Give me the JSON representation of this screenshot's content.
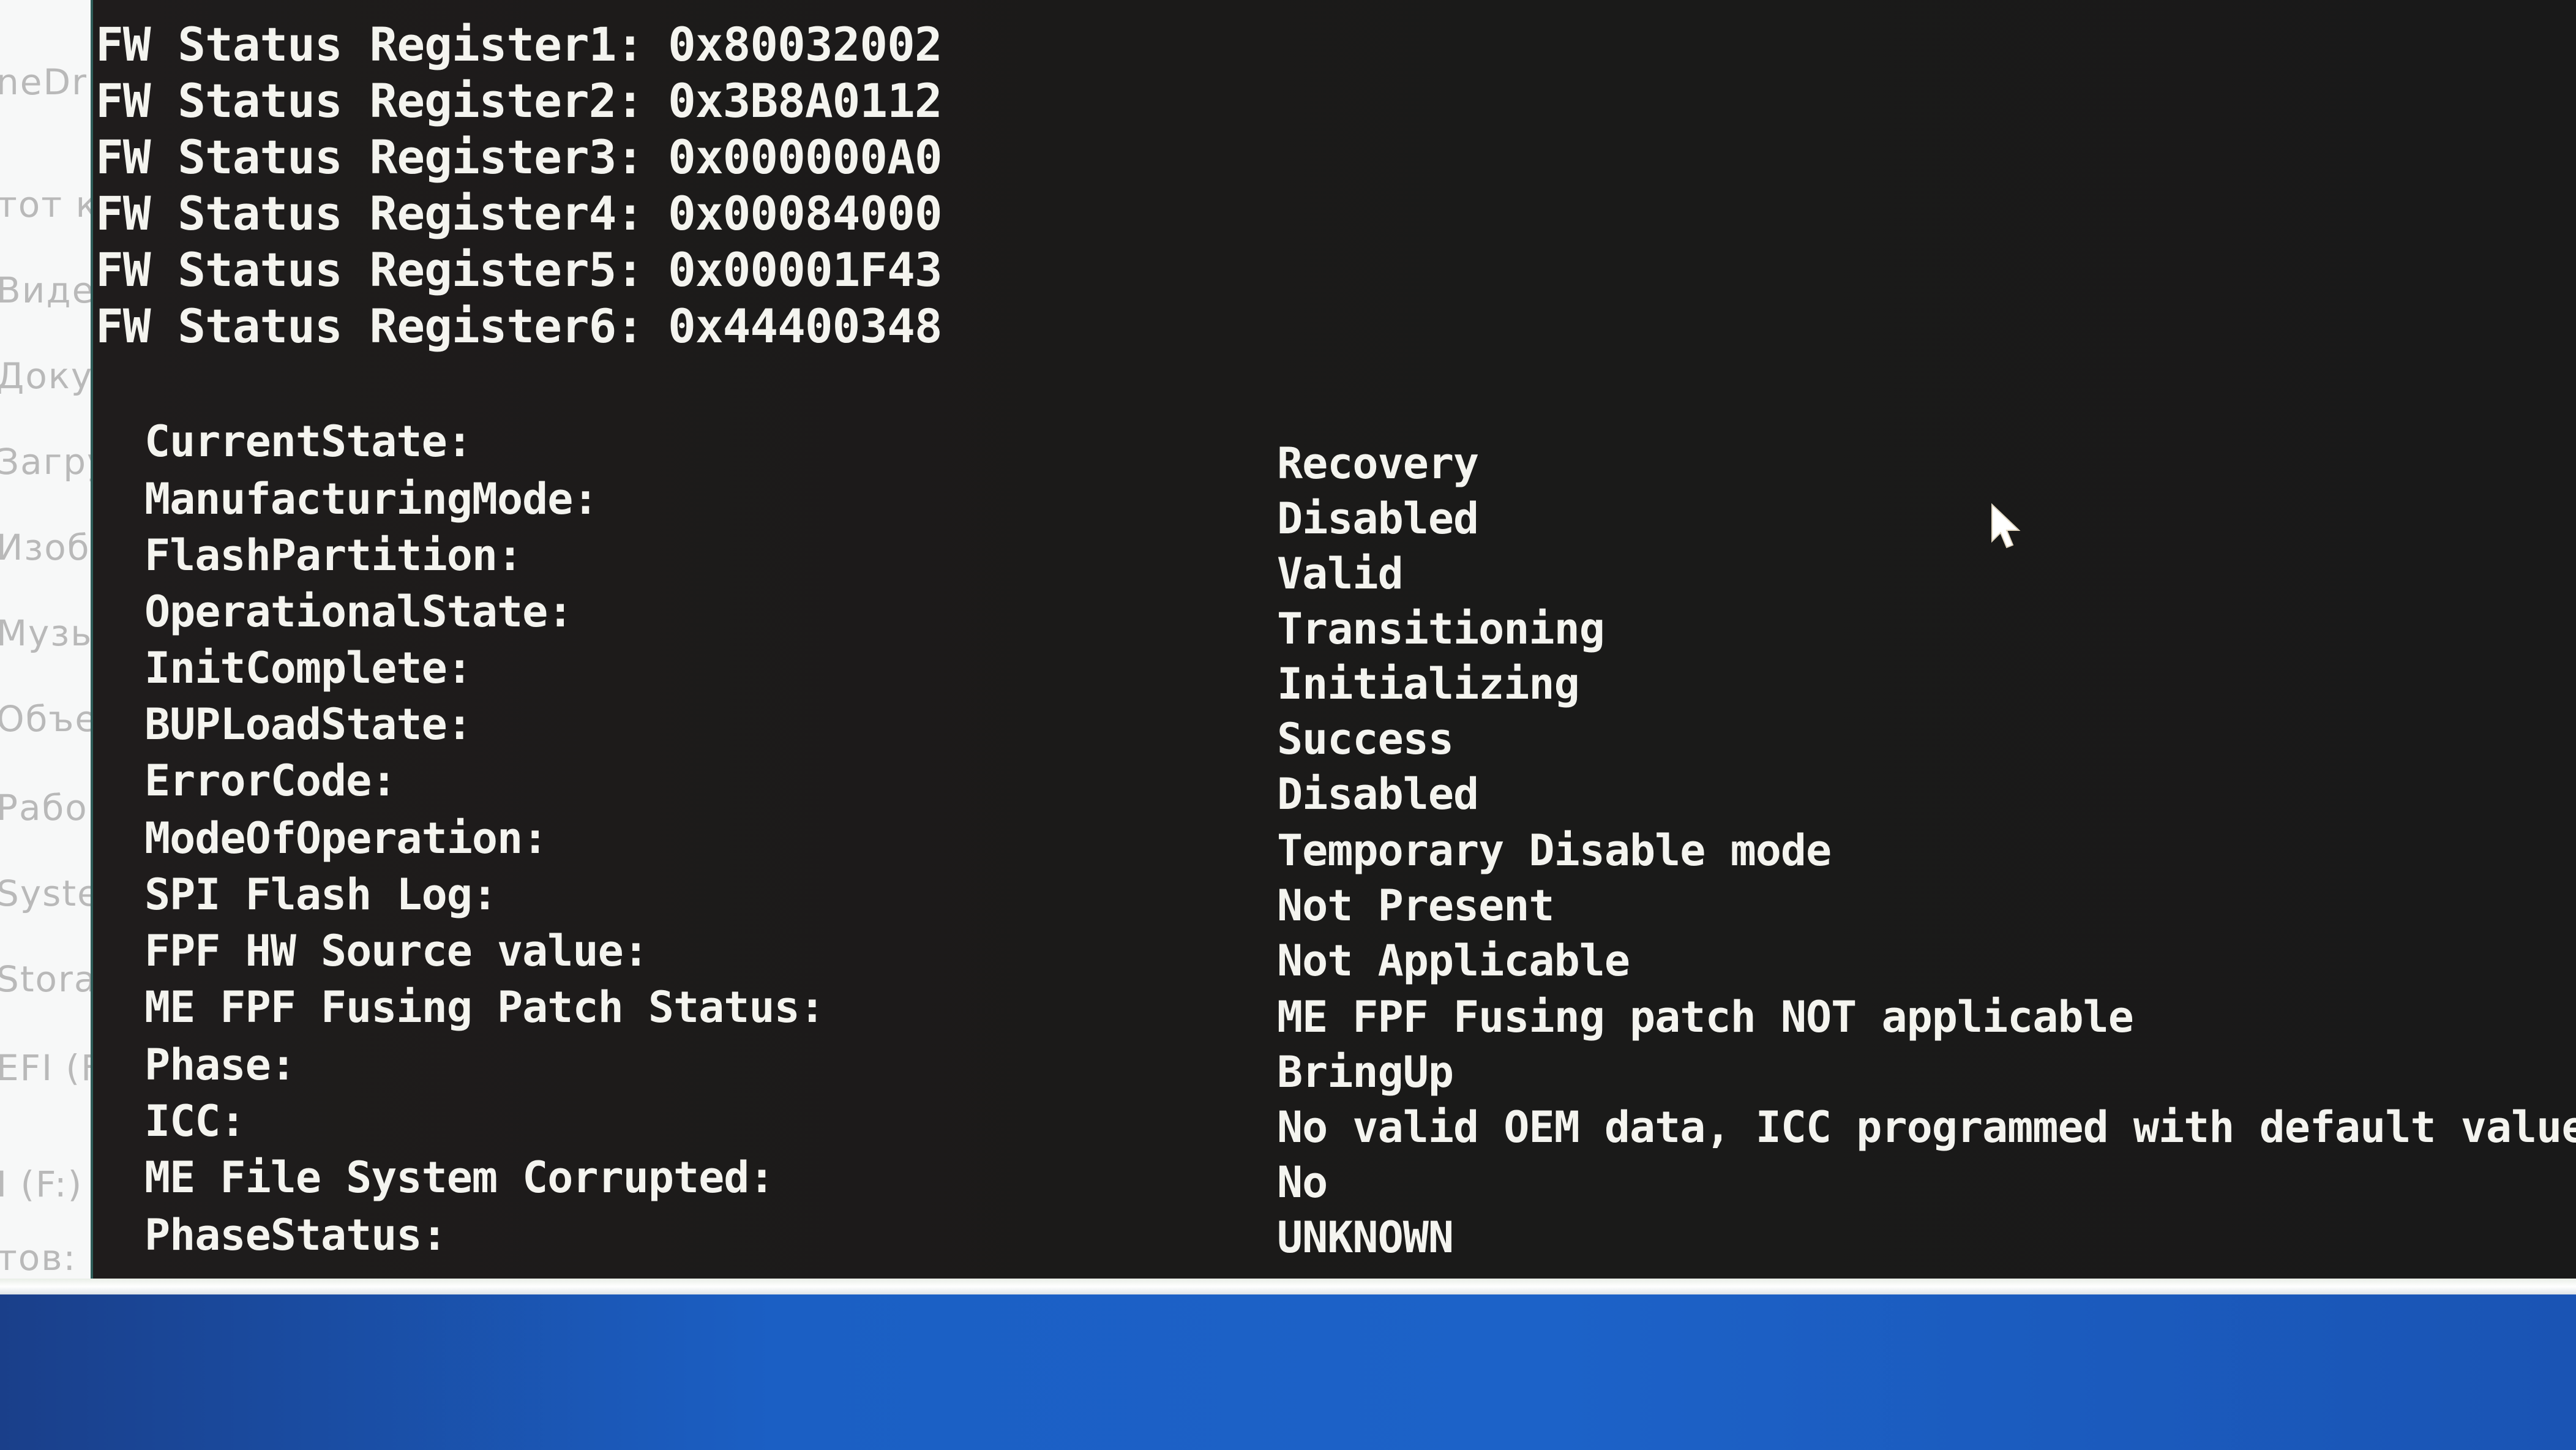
{
  "explorer_sidebar": {
    "items": [
      {
        "label": "neDr"
      },
      {
        "label": "тот ко"
      },
      {
        "label": "Виде"
      },
      {
        "label": "Доку"
      },
      {
        "label": "Загру"
      },
      {
        "label": "Изоб"
      },
      {
        "label": "Музы"
      },
      {
        "label": "Объе"
      },
      {
        "label": "Рабо"
      },
      {
        "label": "Syste"
      },
      {
        "label": "Stora"
      },
      {
        "label": "EFI (F"
      },
      {
        "label": "I (F:)"
      },
      {
        "label": "тов:"
      }
    ]
  },
  "console": {
    "fw_status_registers": [
      {
        "label": "FW Status Register1:",
        "value": "0x80032002"
      },
      {
        "label": "FW Status Register2:",
        "value": "0x3B8A0112"
      },
      {
        "label": "FW Status Register3:",
        "value": "0x000000A0"
      },
      {
        "label": "FW Status Register4:",
        "value": "0x00084000"
      },
      {
        "label": "FW Status Register5:",
        "value": "0x00001F43"
      },
      {
        "label": "FW Status Register6:",
        "value": "0x44400348"
      }
    ],
    "status_fields": [
      {
        "label": "CurrentState:",
        "value": "Recovery"
      },
      {
        "label": "ManufacturingMode:",
        "value": "Disabled"
      },
      {
        "label": "FlashPartition:",
        "value": "Valid"
      },
      {
        "label": "OperationalState:",
        "value": "Transitioning"
      },
      {
        "label": "InitComplete:",
        "value": "Initializing"
      },
      {
        "label": "BUPLoadState:",
        "value": "Success"
      },
      {
        "label": "ErrorCode:",
        "value": "Disabled"
      },
      {
        "label": "ModeOfOperation:",
        "value": "Temporary Disable mode"
      },
      {
        "label": "SPI Flash Log:",
        "value": "Not Present"
      },
      {
        "label": "FPF HW Source value:",
        "value": "Not Applicable"
      },
      {
        "label": "ME FPF Fusing Patch Status:",
        "value": "ME FPF Fusing patch NOT applicable"
      },
      {
        "label": "Phase:",
        "value": "BringUp"
      },
      {
        "label": "ICC:",
        "value": "No valid OEM data, ICC programmed with default values"
      },
      {
        "label": "ME File System Corrupted:",
        "value": "No"
      },
      {
        "label": "PhaseStatus:",
        "value": "UNKNOWN"
      }
    ]
  },
  "icons": {
    "cursor": "mouse-pointer-arrow"
  },
  "colors": {
    "console_background": "#1b1a19",
    "console_text": "#f4f4ef",
    "explorer_background": "#f7f8f8",
    "desktop_blue": "#1c62c8"
  }
}
